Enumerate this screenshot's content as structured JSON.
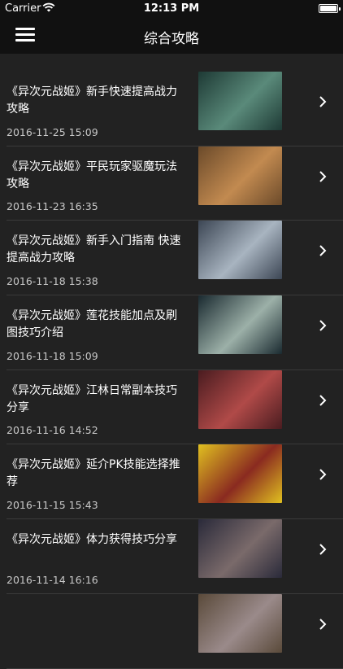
{
  "status_bar": {
    "carrier": "Carrier",
    "time": "12:13 PM"
  },
  "nav": {
    "title": "综合攻略"
  },
  "articles": [
    {
      "title": "《异次元战姬》新手快速提高战力攻略",
      "date": "2016-11-25 15:09",
      "thumb_colors": [
        "#1e3a35",
        "#5a8a7a"
      ]
    },
    {
      "title": "《异次元战姬》平民玩家驱魔玩法攻略",
      "date": "2016-11-23 16:35",
      "thumb_colors": [
        "#6b4a2a",
        "#c28a50"
      ]
    },
    {
      "title": "《异次元战姬》新手入门指南 快速提高战力攻略",
      "date": "2016-11-18 15:38",
      "thumb_colors": [
        "#3c4654",
        "#a8b4c0"
      ]
    },
    {
      "title": "《异次元战姬》莲花技能加点及刷图技巧介绍",
      "date": "2016-11-18 15:09",
      "thumb_colors": [
        "#1a2a30",
        "#9cb0a8"
      ]
    },
    {
      "title": "《异次元战姬》江林日常副本技巧分享",
      "date": "2016-11-16 14:52",
      "thumb_colors": [
        "#4a1c20",
        "#b04a48"
      ]
    },
    {
      "title": "《异次元战姬》延介PK技能选择推荐",
      "date": "2016-11-15 15:43",
      "thumb_colors": [
        "#e0c020",
        "#8a2a20"
      ]
    },
    {
      "title": "《异次元战姬》体力获得技巧分享",
      "date": "2016-11-14 16:16",
      "thumb_colors": [
        "#2a2a3a",
        "#7a6a6a"
      ]
    },
    {
      "title": "",
      "date": "",
      "thumb_colors": [
        "#5a4a3a",
        "#9a8a8a"
      ]
    }
  ]
}
